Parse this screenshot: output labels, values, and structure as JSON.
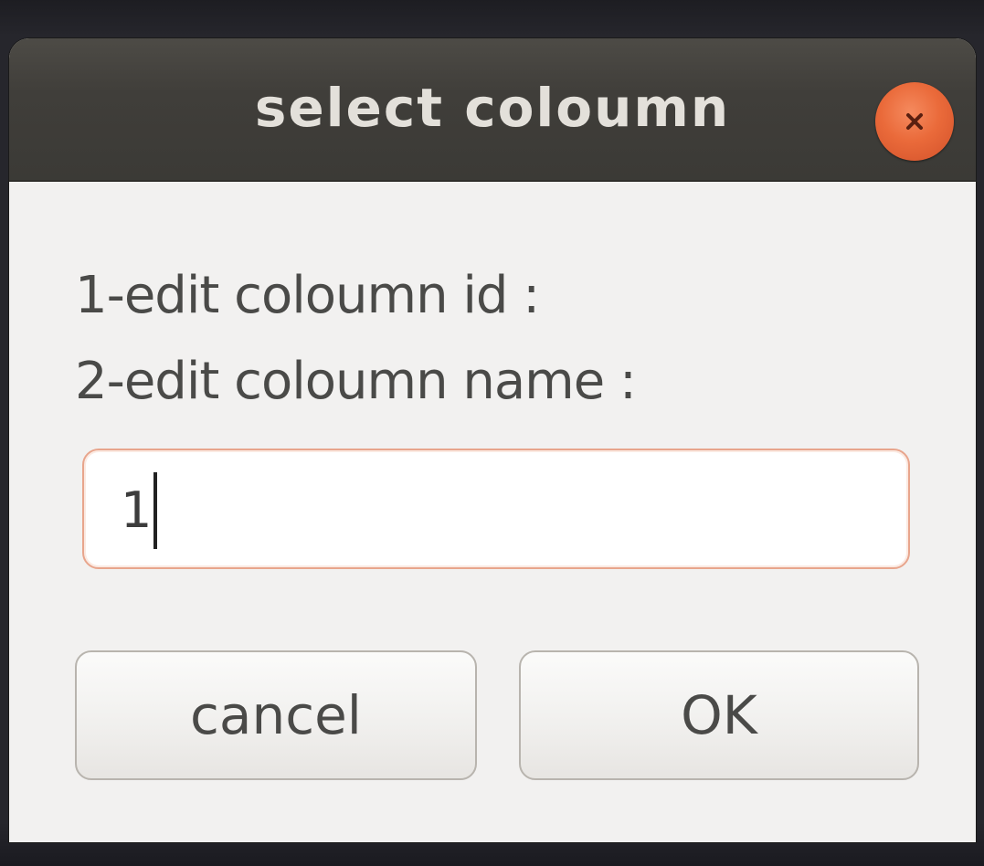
{
  "dialog": {
    "title": "select coloumn",
    "close_icon": "close-icon",
    "prompt_lines": [
      "1-edit coloumn id :",
      "2-edit coloumn name :"
    ],
    "entry_value": "1",
    "buttons": {
      "cancel_label": "cancel",
      "ok_label": "OK"
    }
  },
  "colors": {
    "titlebar": "#403e3a",
    "close_button": "#ea6a3a",
    "entry_focus_border": "#e8a58c"
  }
}
